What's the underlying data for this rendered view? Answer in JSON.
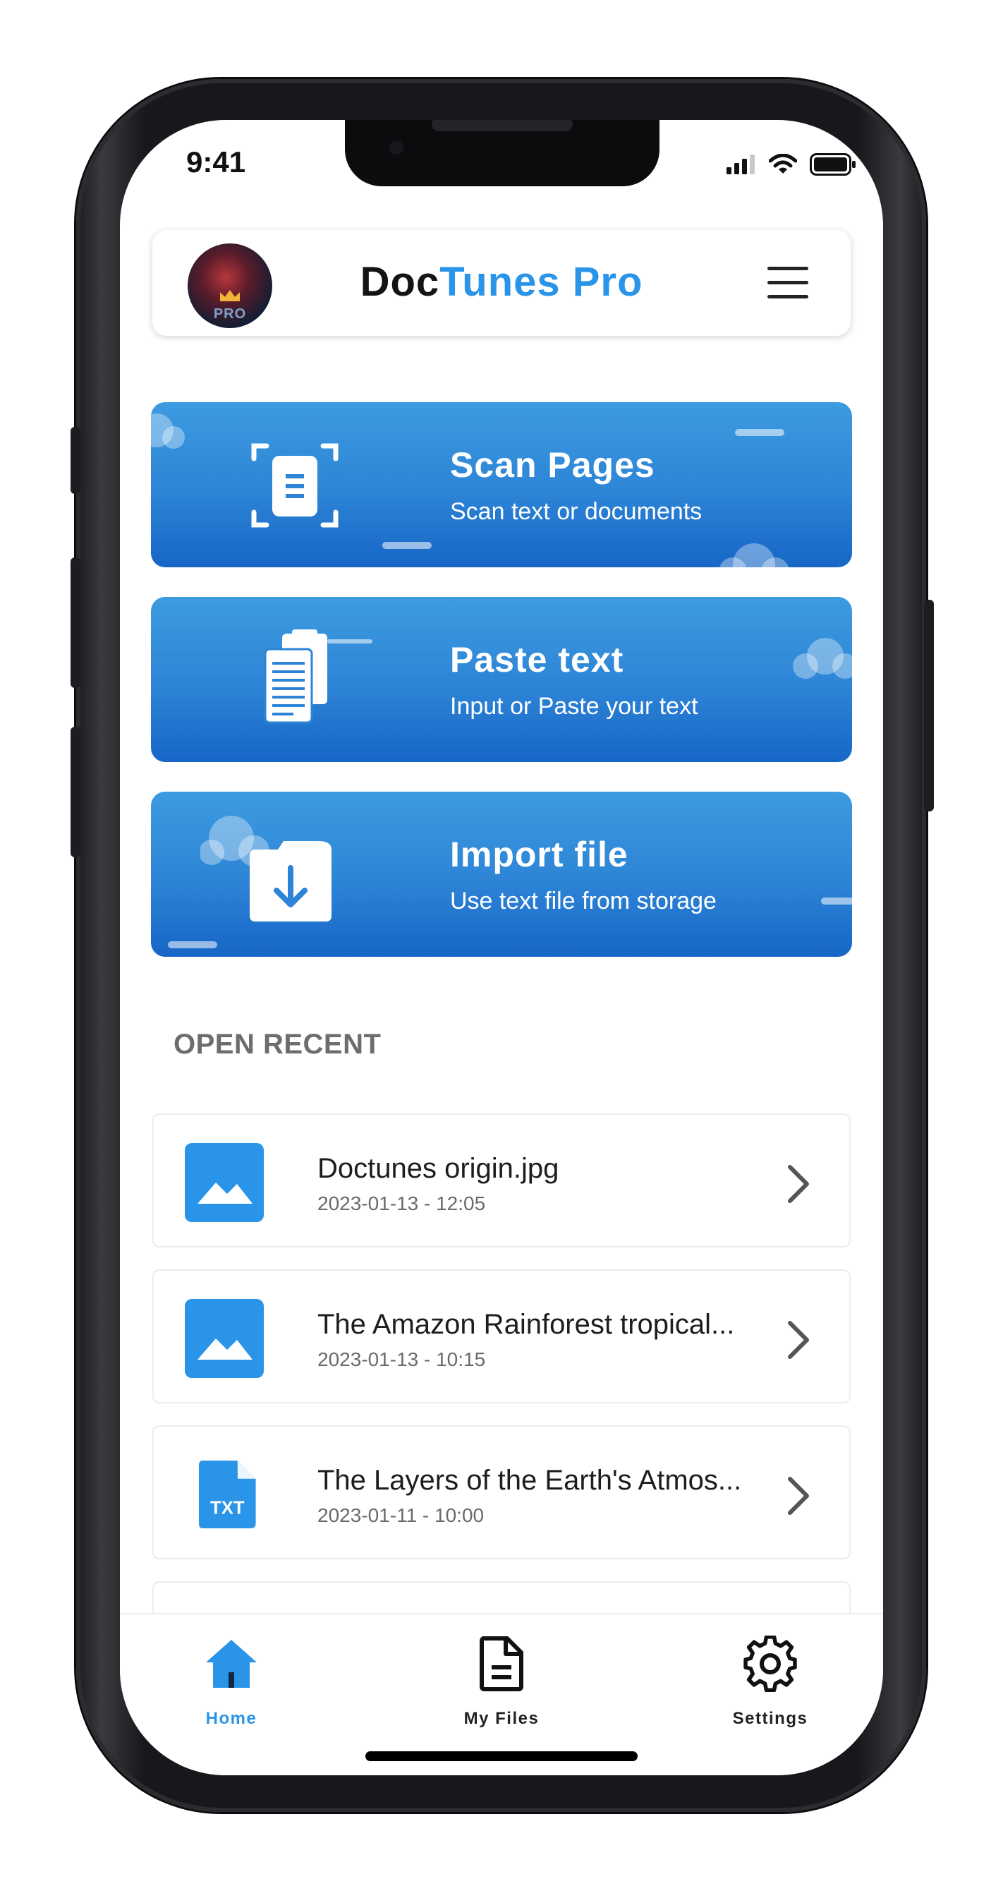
{
  "status_bar": {
    "time": "9:41"
  },
  "header": {
    "avatar_badge": "PRO",
    "title_part1": "Doc",
    "title_part2": "Tunes Pro"
  },
  "actions": [
    {
      "title": "Scan Pages",
      "subtitle": "Scan text or documents",
      "icon": "scan-document-icon"
    },
    {
      "title": "Paste text",
      "subtitle": "Input or Paste your text",
      "icon": "paste-clipboard-icon"
    },
    {
      "title": "Import file",
      "subtitle": "Use text file from storage",
      "icon": "import-download-icon"
    }
  ],
  "recent": {
    "section_title": "OPEN RECENT",
    "items": [
      {
        "name": "Doctunes origin.jpg",
        "date": "2023-01-13 - 12:05",
        "icon": "image-file-icon"
      },
      {
        "name": "The Amazon Rainforest tropical...",
        "date": "2023-01-13 - 10:15",
        "icon": "image-file-icon"
      },
      {
        "name": "The Layers of the Earth's Atmos...",
        "date": "2023-01-11 - 10:00",
        "icon": "txt-file-icon",
        "icon_label": "TXT"
      }
    ]
  },
  "tabbar": {
    "tabs": [
      {
        "label": "Home",
        "icon": "home-icon",
        "active": true
      },
      {
        "label": "My Files",
        "icon": "document-icon",
        "active": false
      },
      {
        "label": "Settings",
        "icon": "gear-icon",
        "active": false
      }
    ]
  },
  "colors": {
    "accent": "#2a94e8",
    "card_top": "#3d9be0",
    "card_bottom": "#1766c6",
    "tab_active": "#2a94e8"
  }
}
